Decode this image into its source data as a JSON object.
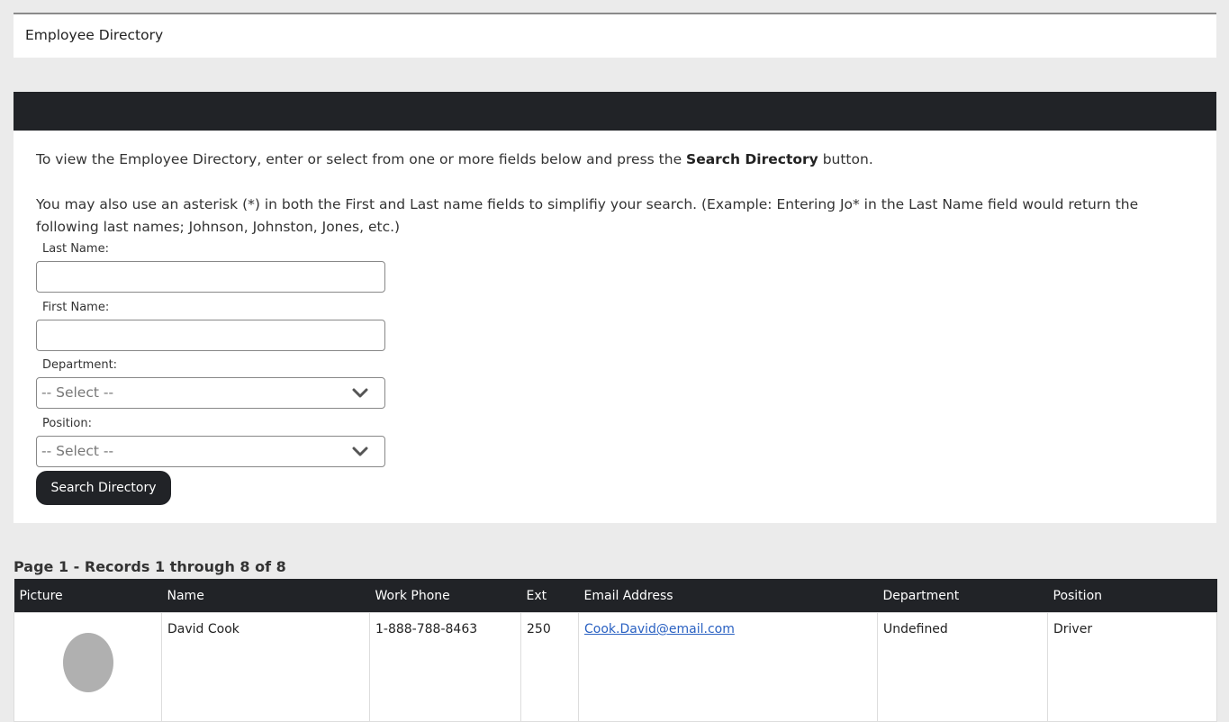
{
  "header": {
    "title": "Employee Directory"
  },
  "intro": {
    "line1_pre": "To view the Employee Directory, enter or select from one or more fields below and press the ",
    "line1_bold": "Search Directory",
    "line1_post": " button.",
    "line2": "You may also use an asterisk (*) in both the First and Last name fields to simplifiy your search. (Example: Entering Jo* in the Last Name field would return the following last names; Johnson, Johnston, Jones, etc.)"
  },
  "form": {
    "last_name_label": "Last Name:",
    "last_name_value": "",
    "first_name_label": "First Name:",
    "first_name_value": "",
    "department_label": "Department:",
    "department_value": "-- Select --",
    "position_label": "Position:",
    "position_value": "-- Select --",
    "search_button": "Search Directory"
  },
  "results": {
    "summary": "Page 1 - Records 1 through 8 of 8",
    "columns": [
      "Picture",
      "Name",
      "Work Phone",
      "Ext",
      "Email Address",
      "Department",
      "Position"
    ],
    "rows": [
      {
        "name": "David Cook",
        "work_phone": "1-888-788-8463",
        "ext": "250",
        "email": "Cook.David@email.com",
        "department": "Undefined",
        "position": "Driver"
      }
    ]
  },
  "colors": {
    "dark": "#212327",
    "link": "#2a61c2",
    "background": "#ebebeb"
  },
  "icons": {
    "select_chevron": "chevron-down-icon",
    "avatar": "avatar-placeholder"
  }
}
